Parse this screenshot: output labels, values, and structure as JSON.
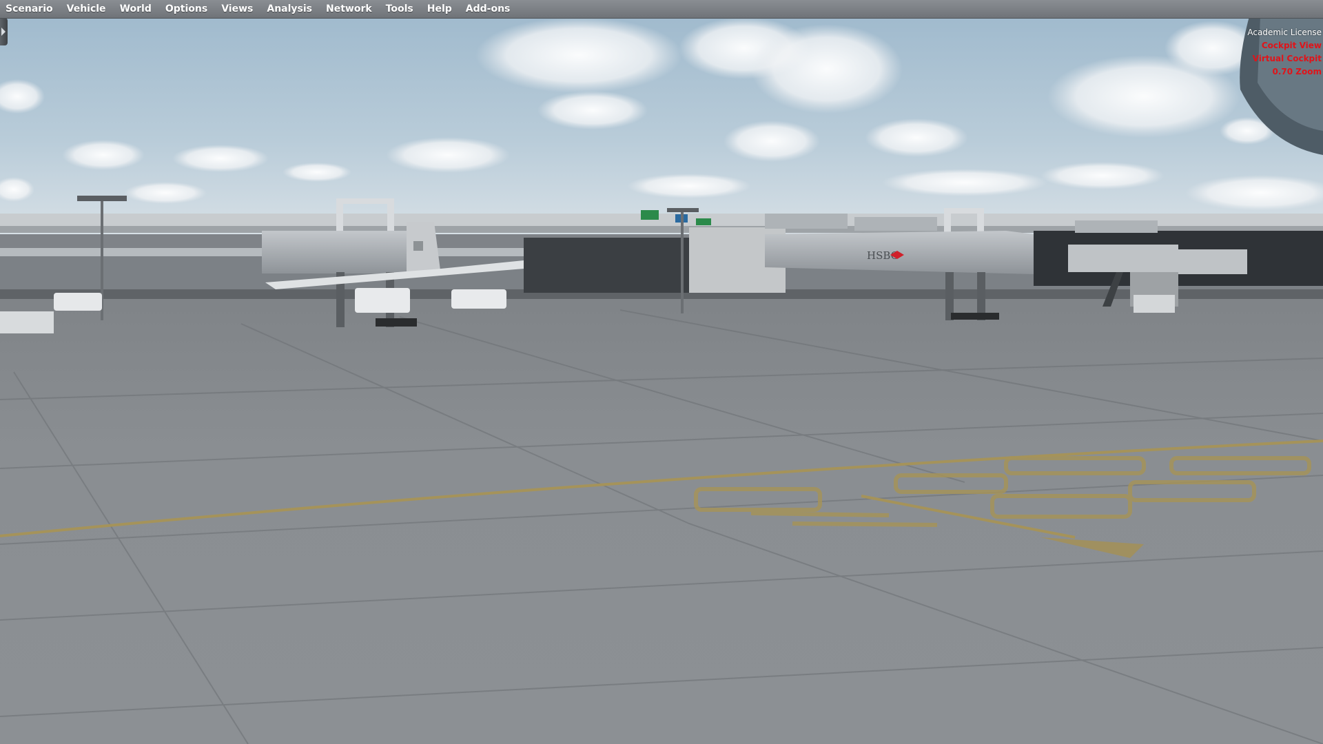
{
  "menu": {
    "items": [
      {
        "key": "scenario",
        "label": "Scenario"
      },
      {
        "key": "vehicle",
        "label": "Vehicle"
      },
      {
        "key": "world",
        "label": "World"
      },
      {
        "key": "options",
        "label": "Options"
      },
      {
        "key": "views",
        "label": "Views"
      },
      {
        "key": "analysis",
        "label": "Analysis"
      },
      {
        "key": "network",
        "label": "Network"
      },
      {
        "key": "tools",
        "label": "Tools"
      },
      {
        "key": "help",
        "label": "Help"
      },
      {
        "key": "addons",
        "label": "Add-ons"
      }
    ]
  },
  "overlay": {
    "license": "Academic License",
    "view": "Cockpit View",
    "sub_view": "Virtual Cockpit",
    "zoom": "0.70 Zoom"
  },
  "scene": {
    "jetway_sign": "HSBC",
    "taxiway_marking": "D11 D5"
  },
  "colors": {
    "menu_text": "#ffffff",
    "overlay_red": "#e0141a",
    "taxi_line": "#a5935a",
    "sky_top": "#9db8cc",
    "apron": "#85898d"
  },
  "icons": {
    "side_handle": "chevron-right-icon",
    "jetway_logo": "hsbc-logo-icon"
  }
}
